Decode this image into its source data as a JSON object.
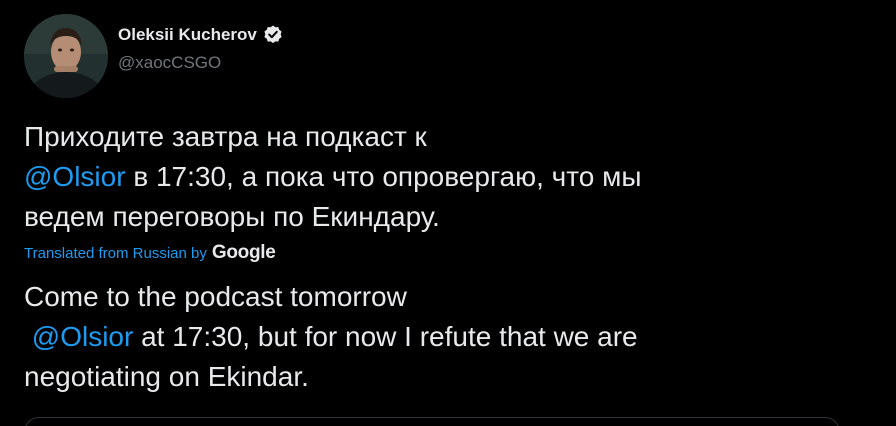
{
  "author": {
    "display_name": "Oleksii Kucherov",
    "handle": "@xaocCSGO",
    "verified": true
  },
  "tweet": {
    "line1": "Приходите завтра на подкаст к",
    "mention": "@Olsior",
    "line2_rest": " в 17:30, а пока что опровергаю, что мы",
    "line3": "ведем переговоры по Екиндару."
  },
  "translation": {
    "label": "Translated from Russian by",
    "provider": "Google",
    "line1": "Come to the podcast tomorrow",
    "line2_prefix": " ",
    "mention": "@Olsior",
    "line2_rest": " at 17:30, but for now I refute that we are",
    "line3": "negotiating on Ekindar."
  },
  "colors": {
    "background": "#000000",
    "text": "#e7e9ea",
    "secondary": "#71767b",
    "accent": "#1d9bf0",
    "border": "#2f3336"
  },
  "icons": {
    "verified": "verified-badge-icon",
    "avatar": "profile-photo"
  }
}
